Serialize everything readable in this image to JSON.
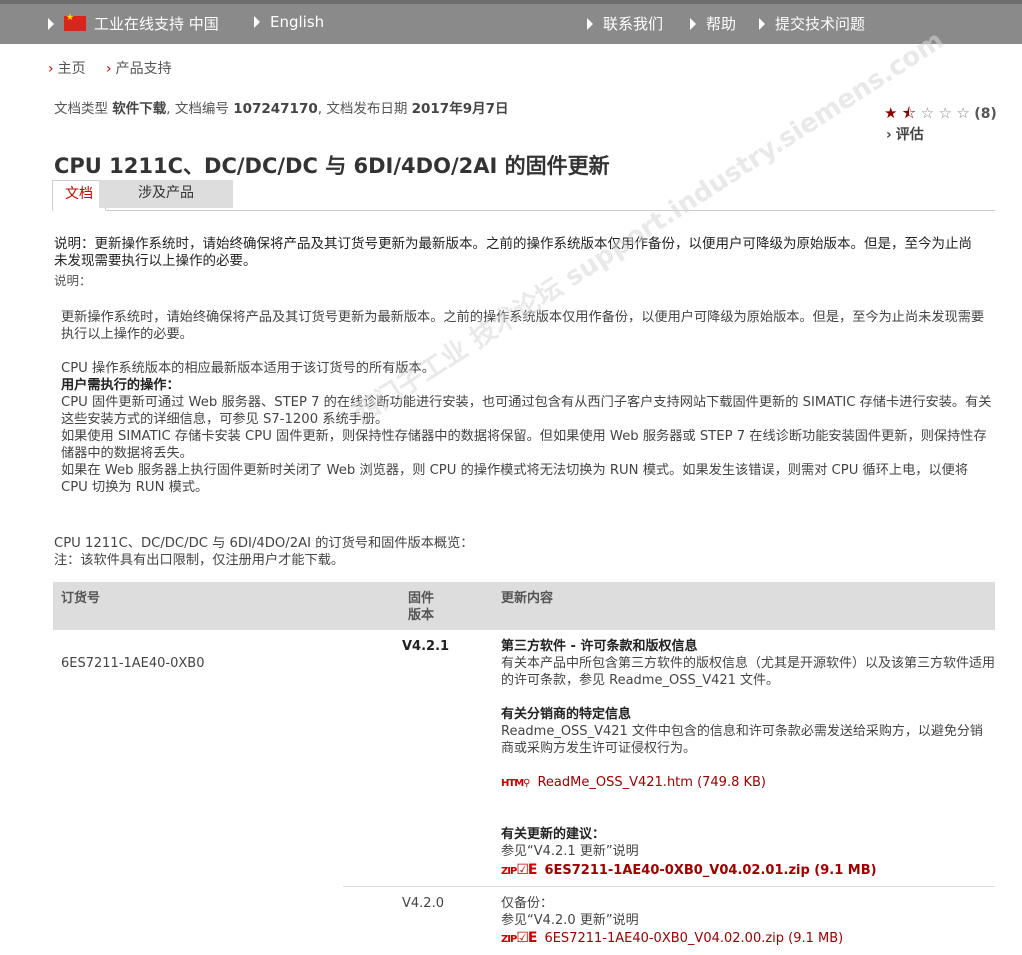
{
  "topbar": {
    "region_label": "工业在线支持 中国",
    "language": "English",
    "contact": "联系我们",
    "help": "帮助",
    "submit_issue": "提交技术问题"
  },
  "breadcrumb": [
    "主页",
    "产品支持"
  ],
  "meta": {
    "type_label": "文档类型",
    "type_value": "软件下载",
    "id_label": ", 文档编号",
    "id_value": "107247170",
    "date_label": ", 文档发布日期",
    "date_value": "2017年9月7日"
  },
  "rating": {
    "stars": 1.5,
    "max": 5,
    "count": "(8)",
    "rate_link": "评估"
  },
  "title": "CPU 1211C、DC/DC/DC 与 6DI/4DO/2AI 的固件更新",
  "tabs": [
    "文档",
    "涉及产品"
  ],
  "notice_bold": "说明：更新操作系统时，请始终确保将产品及其订货号更新为最新版本。之前的操作系统版本仅用作备份，以便用户可降级为原始版本。但是，至今为止尚未发现需要执行以上操作的必要。",
  "notice_label": "说明：",
  "body": {
    "p1": "更新操作系统时，请始终确保将产品及其订货号更新为最新版本。之前的操作系统版本仅用作备份，以便用户可降级为原始版本。但是，至今为止尚未发现需要执行以上操作的必要。",
    "p2": "CPU 操作系统版本的相应最新版本适用于该订货号的所有版本。",
    "p3_head": "用户需执行的操作：",
    "p3": "CPU 固件更新可通过 Web 服务器、STEP 7 的在线诊断功能进行安装，也可通过包含有从西门子客户支持网站下载固件更新的 SIMATIC 存储卡进行安装。有关这些安装方式的详细信息，可参见 S7-1200 系统手册。",
    "p4": "如果使用 SIMATIC 存储卡安装 CPU 固件更新，则保持性存储器中的数据将保留。但如果使用 Web 服务器或 STEP 7 在线诊断功能安装固件更新，则保持性存储器中的数据将丢失。",
    "p5": "如果在 Web 服务器上执行固件更新时关闭了 Web 浏览器，则 CPU 的操作模式将无法切换为 RUN 模式。如果发生该错误，则需对 CPU 循环上电，以便将 CPU 切换为 RUN 模式。"
  },
  "overview": {
    "line1": "CPU 1211C、DC/DC/DC 与 6DI/4DO/2AI 的订货号和固件版本概览：",
    "line2": "注：该软件具有出口限制，仅注册用户才能下载。"
  },
  "table": {
    "headers": [
      "订货号",
      "固件\n版本",
      "更新内容"
    ],
    "order_number": "6ES7211-1AE40-0XB0",
    "rows": [
      {
        "version": "V4.2.1",
        "sec1_title": "第三方软件 - 许可条款和版权信息",
        "sec1_text": "有关本产品中所包含第三方软件的版权信息（尤其是开源软件）以及该第三方软件适用的许可条款，参见 Readme_OSS_V421 文件。",
        "sec2_title": "有关分销商的特定信息",
        "sec2_text": "Readme_OSS_V421 文件中包含的信息和许可条款必需发送给采购方，以避免分销商或采购方发生许可证侵权行为。",
        "file1": "ReadMe_OSS_V421.htm (749.8 KB)",
        "sec3_title": "有关更新的建议：",
        "sec3_text": "参见“V4.2.1 更新”说明",
        "file2": "6ES7211-1AE40-0XB0_V04.02.01.zip (9.1 MB)"
      },
      {
        "version": "V4.2.0",
        "sec1_title": "仅备份：",
        "sec1_text": "参见“V4.2.0 更新”说明",
        "file1": "6ES7211-1AE40-0XB0_V04.02.00.zip (9.1 MB)"
      }
    ]
  },
  "icons": {
    "html_file": "HTM",
    "zip_file": "ZIP"
  },
  "watermark": "西门子工业 技术论坛 support.industry.siemens.com"
}
